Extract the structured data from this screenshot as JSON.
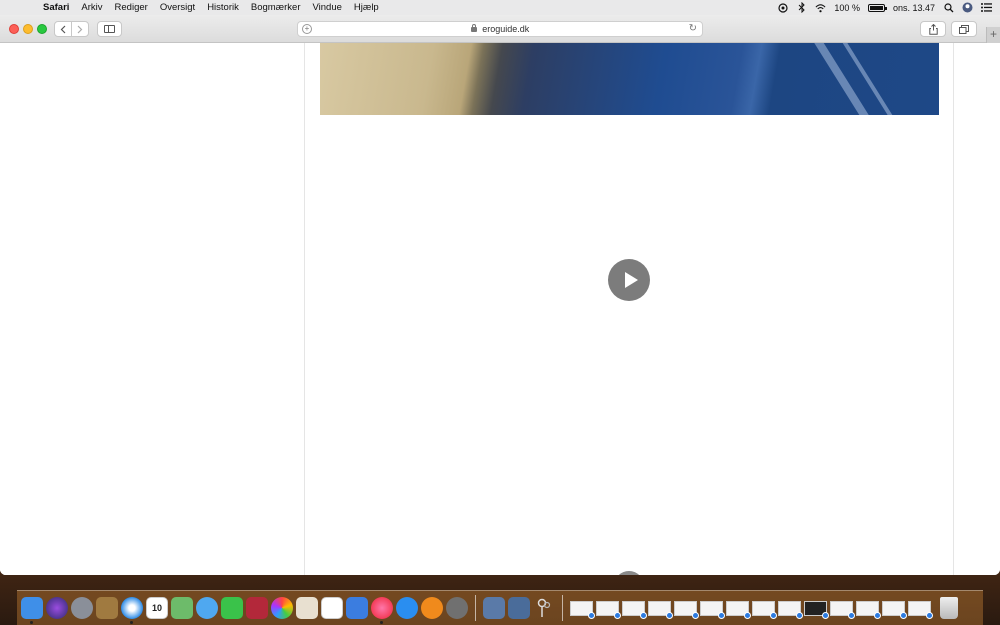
{
  "menubar": {
    "apple_symbol": "",
    "app_name": "Safari",
    "items": [
      "Arkiv",
      "Rediger",
      "Oversigt",
      "Historik",
      "Bogmærker",
      "Vindue",
      "Hjælp"
    ],
    "battery_text": "100 %",
    "clock": "ons. 13.47"
  },
  "browser": {
    "url": "eroguide.dk",
    "new_tab_symbol": "+"
  },
  "dock": {
    "calendar_day": "10"
  },
  "colors": {
    "accent": "#2c7be0",
    "play_button": "#7c7c7c"
  }
}
